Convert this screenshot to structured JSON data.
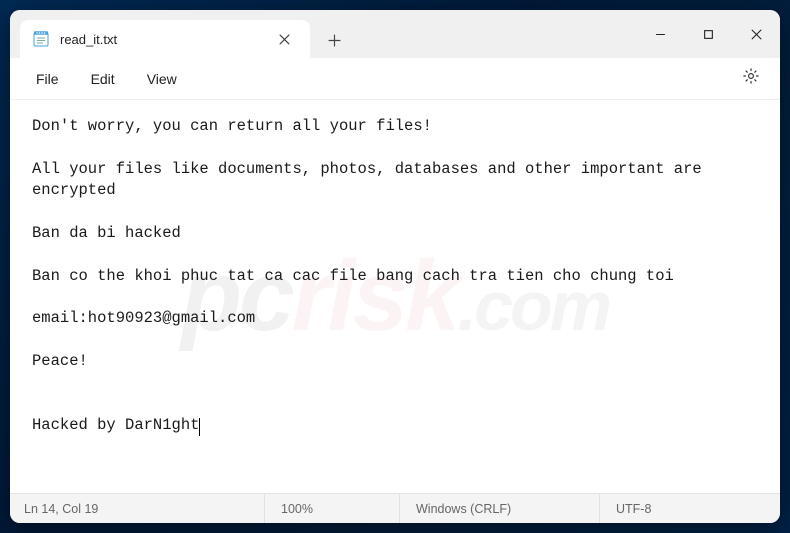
{
  "tab": {
    "title": "read_it.txt"
  },
  "menu": {
    "file": "File",
    "edit": "Edit",
    "view": "View"
  },
  "content": "Don't worry, you can return all your files!\n\nAll your files like documents, photos, databases and other important are encrypted\n\nBan da bi hacked\n\nBan co the khoi phuc tat ca cac file bang cach tra tien cho chung toi\n\nemail:hot90923@gmail.com\n\nPeace!\n\n\nHacked by DarN1ght",
  "status": {
    "position": "Ln 14, Col 19",
    "zoom": "100%",
    "line_ending": "Windows (CRLF)",
    "encoding": "UTF-8"
  },
  "icons": {
    "notepad": "notepad-icon",
    "close_tab": "close-icon",
    "new_tab": "plus-icon",
    "minimize": "minimize-icon",
    "maximize": "maximize-icon",
    "close_window": "close-icon",
    "settings": "gear-icon"
  },
  "watermark": {
    "p1": "pc",
    "p2": "risk",
    "p3": ".com"
  }
}
